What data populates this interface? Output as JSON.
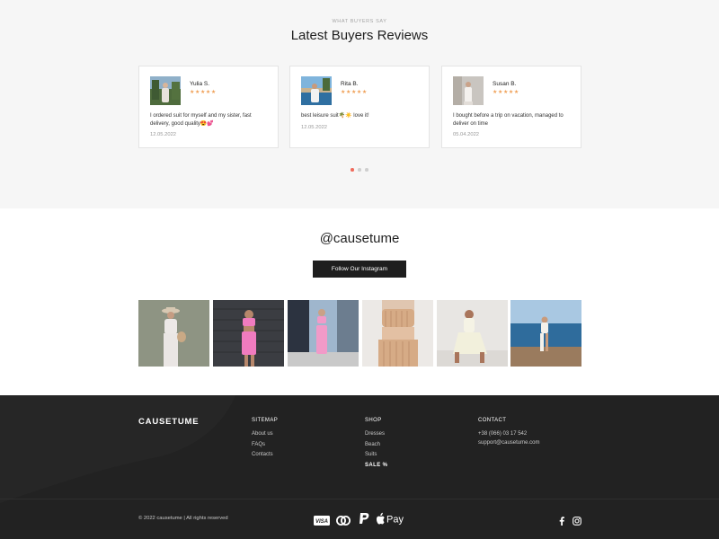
{
  "reviews": {
    "eyebrow": "WHAT BUYERS SAY",
    "title": "Latest Buyers Reviews",
    "stars": "★★★★★",
    "items": [
      {
        "name": "Yulia S.",
        "text": "I ordered suit for myself and my sister, fast delivery, good quality😍💕",
        "date": "12.05.2022"
      },
      {
        "name": "Rita B.",
        "text": "best leisure suit🌴☀️ love it!",
        "date": "12.05.2022"
      },
      {
        "name": "Susan B.",
        "text": "I bought before a trip on vacation, managed to deliver on time",
        "date": "05.04.2022"
      }
    ]
  },
  "instagram": {
    "handle": "@causetume",
    "button": "Follow Our Instagram"
  },
  "footer": {
    "brand": "CAUSETUME",
    "sitemap": {
      "title": "SITEMAP",
      "links": [
        "About us",
        "FAQs",
        "Contacts"
      ]
    },
    "shop": {
      "title": "SHOP",
      "links": [
        "Dresses",
        "Beach",
        "Suits"
      ],
      "sale": "SALE %"
    },
    "contact": {
      "title": "CONTACT",
      "phone": "+38 (066) 03 17 542",
      "email": "support@causetume.com"
    },
    "copyright": "© 2022 causetume | All rights reserved",
    "payments": [
      "visa-icon",
      "mastercard-icon",
      "paypal-icon",
      "apple-pay-icon"
    ],
    "visa_label": "VISA",
    "apple_pay_label": "Pay",
    "socials": [
      "facebook-icon",
      "instagram-icon"
    ]
  }
}
